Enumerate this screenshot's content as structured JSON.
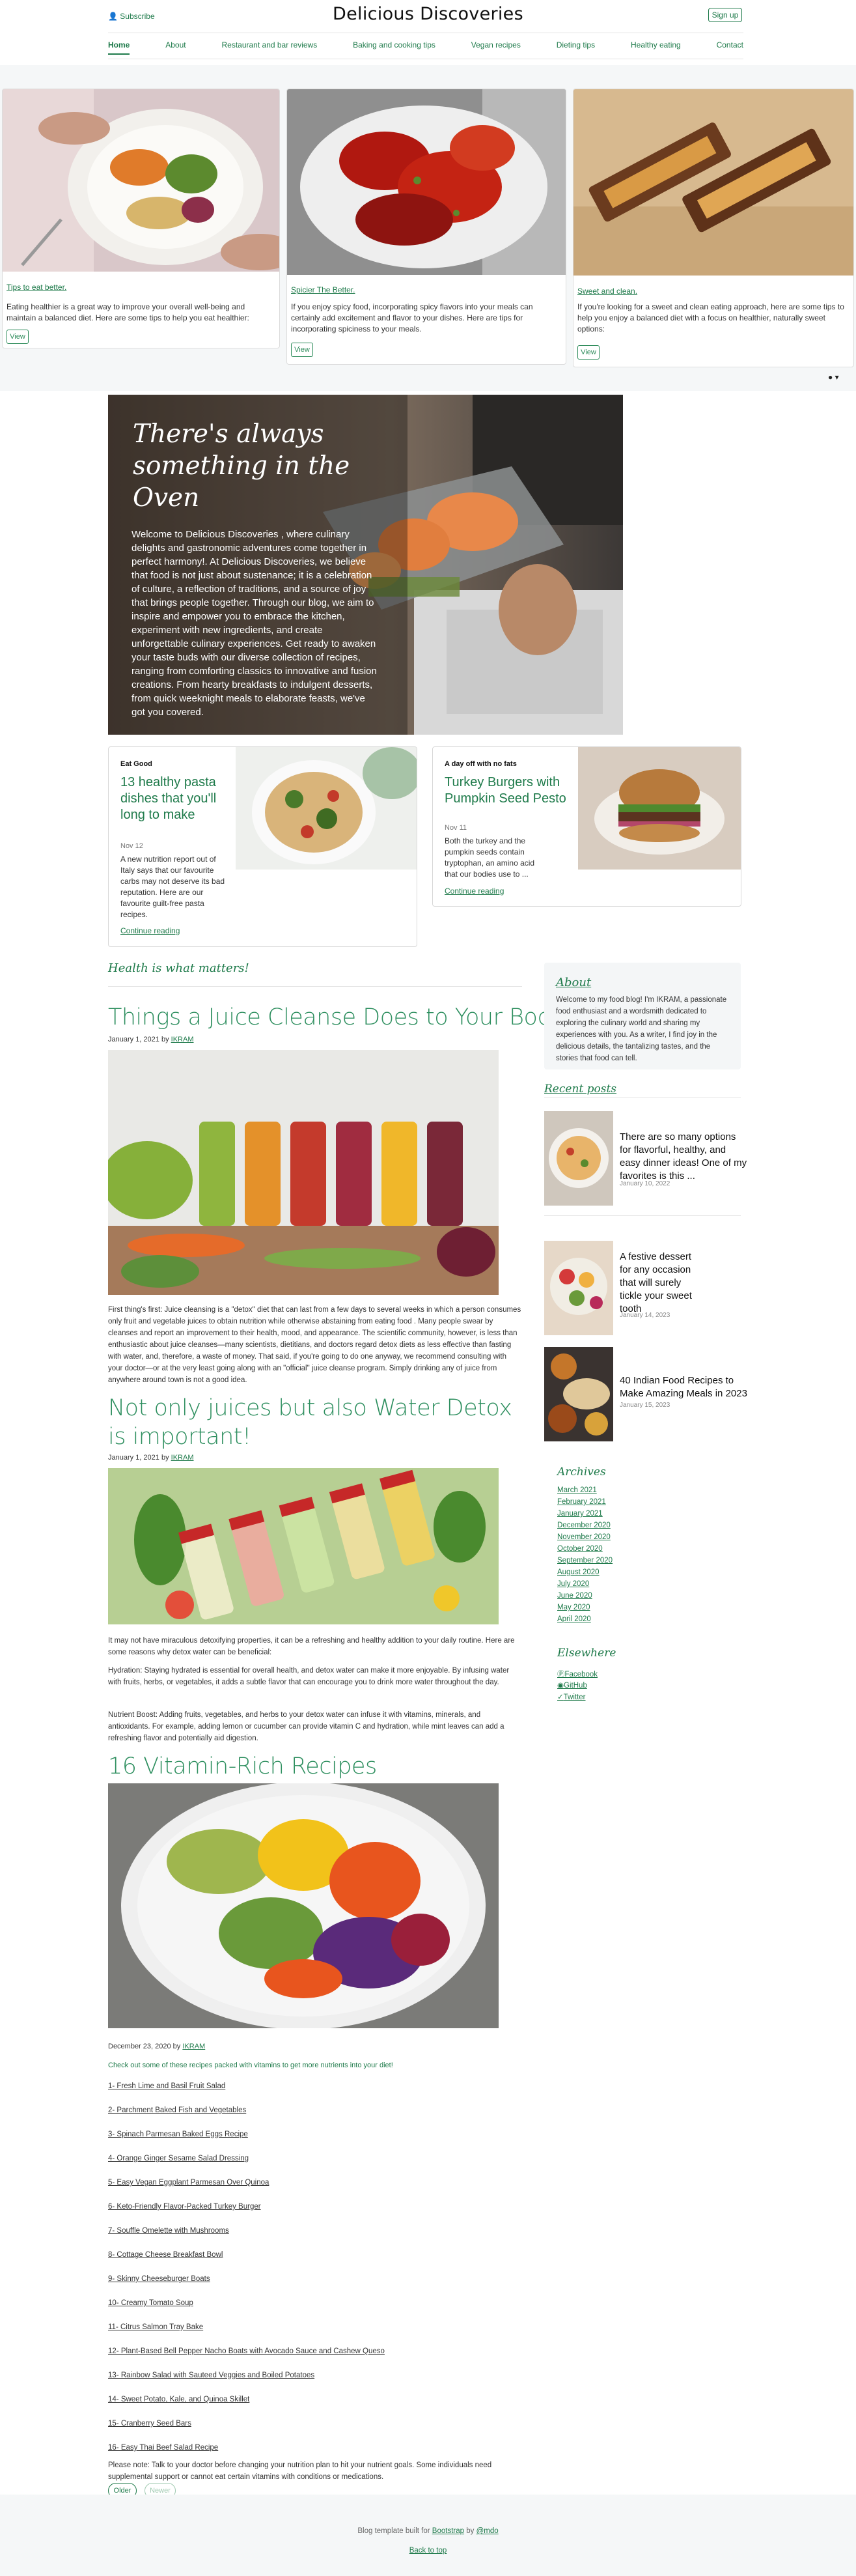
{
  "header": {
    "subscribe": "Subscribe",
    "brand": "Delicious Discoveries",
    "signup": "Sign up",
    "nav": [
      "Home",
      "About",
      "Restaurant and bar reviews",
      "Baking and cooking tips",
      "Vegan recipes",
      "Dieting tips",
      "Healthy eating",
      "Contact"
    ]
  },
  "carousel": {
    "cards": [
      {
        "title": "Tips to eat better.",
        "text": "Eating healthier is a great way to improve your overall well-being and maintain a balanced diet. Here are some tips to help you eat healthier:",
        "button": "View"
      },
      {
        "title": "Spicier The Better.",
        "text": "If you enjoy spicy food, incorporating spicy flavors into your meals can certainly add excitement and flavor to your dishes. Here are tips for incorporating spiciness to your meals.",
        "button": "View"
      },
      {
        "title": "Sweet and clean.",
        "text": "If you're looking for a sweet and clean eating approach, here are some tips to help you enjoy a balanced diet with a focus on healthier, naturally sweet options:",
        "button": "View"
      }
    ],
    "indicator": "● ▾"
  },
  "hero": {
    "title": "There's always something in the Oven",
    "text": "Welcome to Delicious Discoveries , where culinary delights and gastronomic adventures come together in perfect harmony!. At Delicious Discoveries, we believe that food is not just about sustenance; it is a celebration of culture, a reflection of traditions, and a source of joy that brings people together. Through our blog, we aim to inspire and empower you to embrace the kitchen, experiment with new ingredients, and create unforgettable culinary experiences. Get ready to awaken your taste buds with our diverse collection of recipes, ranging from comforting classics to innovative and fusion creations. From hearty breakfasts to indulgent desserts, from quick weeknight meals to elaborate feasts, we've got you covered."
  },
  "featured": [
    {
      "tag": "Eat Good",
      "title": "13 healthy pasta dishes that you'll long to make",
      "date": "Nov 12",
      "text": "A new nutrition report out of Italy says that our favourite carbs may not deserve its bad reputation. Here are our favourite guilt-free pasta recipes.",
      "link": "Continue reading"
    },
    {
      "tag": "A day off with no fats",
      "title": "Turkey Burgers with Pumpkin Seed Pesto",
      "date": "Nov 11",
      "text": "Both the turkey and the pumpkin seeds contain tryptophan, an amino acid that our bodies use to ...",
      "link": "Continue reading"
    }
  ],
  "section_title": "Health is what matters!",
  "posts": [
    {
      "title": "Things a Juice Cleanse Does to Your Body",
      "date": "January 1, 2021 by",
      "author": "IKRAM",
      "body": "First thing's first: Juice cleansing is a \"detox\" diet that can last from a few days to several weeks in which a person consumes only fruit and vegetable juices to obtain nutrition while otherwise abstaining from eating food . Many people swear by cleanses and report an improvement to their health, mood, and appearance. The scientific community, however, is less than enthusiastic about juice cleanses—many scientists, dietitians, and doctors regard detox diets as less effective than fasting with water, and, therefore, a waste of money. That said, if you're going to do one anyway, we recommend consulting with your doctor—or at the very least going along with an \"official\" juice cleanse program. Simply drinking any of juice from anywhere around town is not a good idea."
    },
    {
      "title": "Not only juices but also Water Detox is important!",
      "date": "January 1, 2021 by",
      "author": "IKRAM",
      "p1": "It may not have miraculous detoxifying properties, it can be a refreshing and healthy addition to your daily routine. Here are some reasons why detox water can be beneficial:",
      "p2": "Hydration: Staying hydrated is essential for overall health, and detox water can make it more enjoyable. By infusing water with fruits, herbs, or vegetables, it adds a subtle flavor that can encourage you to drink more water throughout the day.",
      "p3": "Nutrient Boost: Adding fruits, vegetables, and herbs to your detox water can infuse it with vitamins, minerals, and antioxidants. For example, adding lemon or cucumber can provide vitamin C and hydration, while mint leaves can add a refreshing flavor and potentially aid digestion."
    },
    {
      "title": "16 Vitamin-Rich Recipes",
      "date": "December 23, 2020 by",
      "author": "IKRAM",
      "intro": "Check out some of these recipes packed with vitamins to get more nutrients into your diet!",
      "recipes": [
        "1- Fresh Lime and Basil Fruit Salad",
        "2- Parchment Baked Fish and Vegetables",
        "3- Spinach Parmesan Baked Eggs Recipe",
        "4- Orange Ginger Sesame Salad Dressing",
        "5- Easy Vegan Eggplant Parmesan Over Quinoa",
        "6- Keto-Friendly Flavor-Packed Turkey Burger",
        "7- Souffle Omelette with Mushrooms",
        "8- Cottage Cheese Breakfast Bowl",
        "9- Skinny Cheeseburger Boats",
        "10- Creamy Tomato Soup",
        "11- Citrus Salmon Tray Bake",
        "12- Plant-Based Bell Pepper Nacho Boats with Avocado Sauce and Cashew Queso",
        "13- Rainbow Salad with Sauteed Veggies and Boiled Potatoes",
        "14- Sweet Potato, Kale, and Quinoa Skillet",
        "15- Cranberry Seed Bars",
        "16- Easy Thai Beef Salad Recipe"
      ],
      "note": "Please note: Talk to your doctor before changing your nutrition plan to hit your nutrient goals. Some individuals need supplemental support or cannot eat certain vitamins with conditions or medications."
    }
  ],
  "pagination": {
    "older": "Older",
    "newer": "Newer"
  },
  "sidebar": {
    "about_title": "About",
    "about_text": "Welcome to my food blog! I'm IKRAM, a passionate food enthusiast and a wordsmith dedicated to exploring the culinary world and sharing my experiences with you. As a writer, I find joy in the delicious details, the tantalizing tastes, and the stories that food can tell.",
    "recent_title": "Recent posts",
    "recent": [
      {
        "title": "There are so many options for flavorful, healthy, and easy dinner ideas! One of my favorites is this ...",
        "date": "January 10, 2022"
      },
      {
        "title": "A festive dessert for any occasion that will surely tickle your sweet tooth",
        "date": "January 14, 2023"
      },
      {
        "title": "40 Indian Food Recipes to Make Amazing Meals in 2023",
        "date": "January 15, 2023"
      }
    ],
    "archives_title": "Archives",
    "archives": [
      "March 2021",
      "February 2021",
      "January 2021",
      "December 2020",
      "November 2020",
      "October 2020",
      "September 2020",
      "August 2020",
      "July 2020",
      "June 2020",
      "May 2020",
      "April 2020"
    ],
    "elsewhere_title": "Elsewhere",
    "elsewhere": [
      "Facebook",
      "GitHub",
      "Twitter"
    ]
  },
  "footer": {
    "built_prefix": "Blog template built for",
    "bootstrap": "Bootstrap",
    "by": "by",
    "mdo": "@mdo",
    "back": "Back to top"
  }
}
